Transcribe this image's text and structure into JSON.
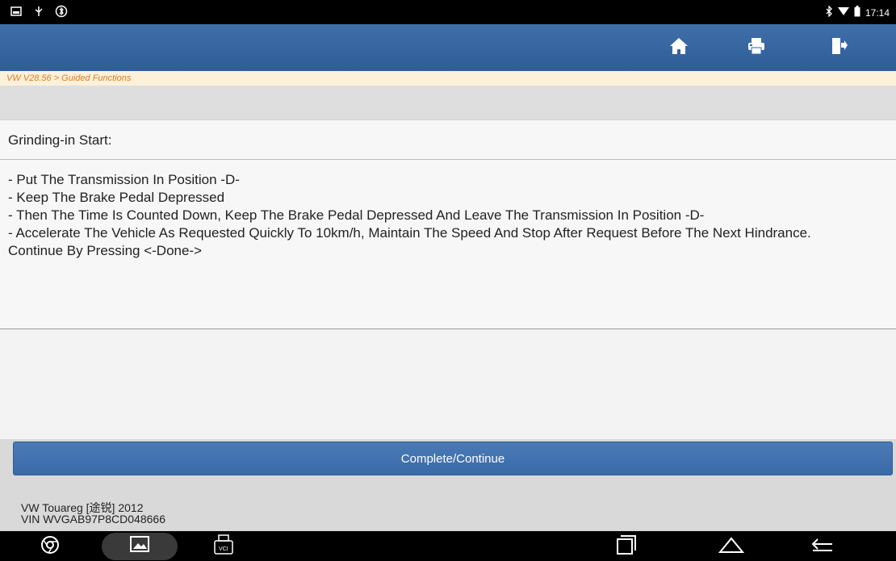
{
  "status_bar": {
    "time": "17:14"
  },
  "header": {
    "icons": [
      "home-icon",
      "print-icon",
      "exit-icon"
    ]
  },
  "breadcrumb": "VW V28.56 > Guided Functions",
  "section_title": "Grinding-in Start:",
  "instructions": [
    "- Put The Transmission In Position -D-",
    "- Keep The Brake Pedal Depressed",
    "- Then The Time Is Counted Down, Keep The Brake Pedal Depressed And Leave The Transmission In Position -D-",
    "- Accelerate The Vehicle As Requested Quickly To 10km/h, Maintain The Speed And Stop After Request Before The Next Hindrance.",
    "Continue By Pressing <-Done->"
  ],
  "action": {
    "label": "Complete/Continue"
  },
  "vehicle": {
    "model": "VW Touareg [途锐] 2012",
    "vin": "VIN WVGAB97P8CD048666"
  },
  "colors": {
    "header": "#3568a6",
    "accent": "#e07a20",
    "button": "#4374b1"
  }
}
